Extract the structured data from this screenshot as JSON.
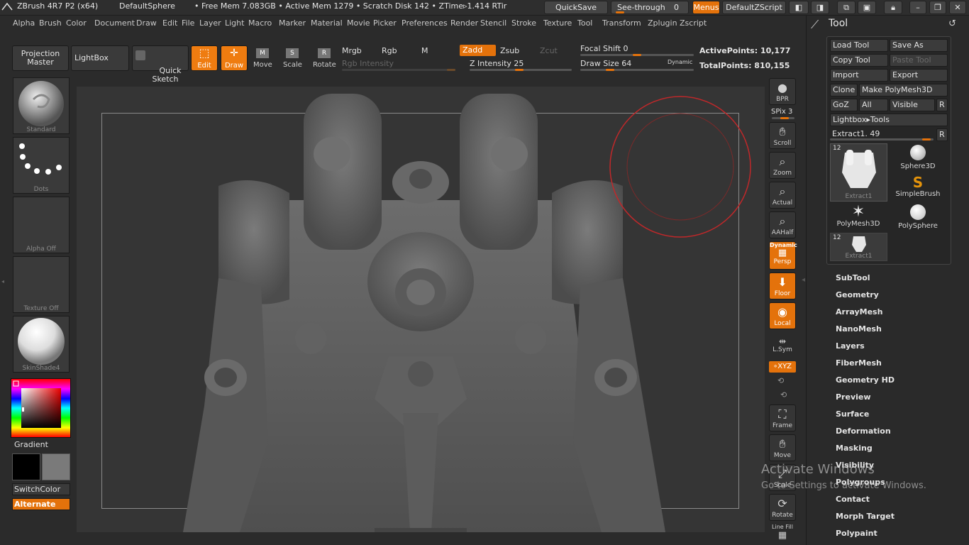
{
  "titlebar": {
    "app": "ZBrush 4R7 P2 (x64)",
    "document": "DefaultSphere",
    "stats": "• Free Mem 7.083GB • Active Mem 1279 • Scratch Disk 142 •  ZTime▹1.414 RTir",
    "quicksave": "QuickSave",
    "see_through": "See-through",
    "see_through_value": "0",
    "menus": "Menus",
    "zscript": "DefaultZScript"
  },
  "menubar": {
    "items": [
      "Alpha",
      "Brush",
      "Color",
      "Document",
      "Draw",
      "Edit",
      "File",
      "Layer",
      "Light",
      "Macro",
      "Marker",
      "Material",
      "Movie",
      "Picker",
      "Preferences",
      "Render",
      "Stencil",
      "Stroke",
      "Texture",
      "Tool",
      "Transform",
      "Zplugin",
      "Zscript"
    ]
  },
  "toolbar": {
    "projection_master": "Projection\nMaster",
    "lightbox": "LightBox",
    "quick_sketch": "Quick\nSketch",
    "edit": "Edit",
    "draw": "Draw",
    "move": "Move",
    "scale": "Scale",
    "rotate": "Rotate",
    "mrgb": "Mrgb",
    "rgb": "Rgb",
    "m": "M",
    "zadd": "Zadd",
    "zsub": "Zsub",
    "zcut": "Zcut",
    "rgb_intensity": "Rgb  Intensity",
    "z_intensity": "Z Intensity 25",
    "z_intensity_value": 25,
    "focal_shift": "Focal Shift 0",
    "focal_shift_value": 0,
    "draw_size": "Draw Size 64",
    "draw_size_value": 64,
    "dynamic": "Dynamic",
    "active_points": "ActivePoints: 10,177",
    "total_points": "TotalPoints: 810,155"
  },
  "leftshelf": {
    "brush": "Standard",
    "stroke": "Dots",
    "alpha": "Alpha  Off",
    "texture": "Texture  Off",
    "material": "SkinShade4",
    "gradient": "Gradient",
    "switch_color": "SwitchColor",
    "alternate": "Alternate"
  },
  "rightshelf": {
    "bpr": "BPR",
    "spix": "SPix 3",
    "scroll": "Scroll",
    "zoom": "Zoom",
    "actual": "Actual",
    "aahalf": "AAHalf",
    "dynamic": "Dynamic",
    "persp": "Persp",
    "floor": "Floor",
    "local": "Local",
    "lsym": "L.Sym",
    "xyz": "∘XYZ",
    "frame": "Frame",
    "move": "Move",
    "scale": "Scale",
    "rotate": "Rotate",
    "line_fill": "Line Fill"
  },
  "toolpanel": {
    "title": "Tool",
    "load_tool": "Load Tool",
    "save_as": "Save As",
    "copy_tool": "Copy Tool",
    "paste_tool": "Paste Tool",
    "import": "Import",
    "export": "Export",
    "clone": "Clone",
    "make_polymesh": "Make PolyMesh3D",
    "goz": "GoZ",
    "all": "All",
    "visible": "Visible",
    "r": "R",
    "lightbox_tools": "Lightbox▸Tools",
    "extract_label": "Extract1. 49",
    "extract_value": 49,
    "tools": [
      {
        "name": "Extract1",
        "count": "12"
      },
      {
        "name": "Sphere3D",
        "count": ""
      },
      {
        "name": "SimpleBrush",
        "count": ""
      },
      {
        "name": "PolyMesh3D",
        "count": ""
      },
      {
        "name": "PolySphere",
        "count": ""
      },
      {
        "name": "Extract1",
        "count": "12"
      }
    ],
    "subpalettes": [
      "SubTool",
      "Geometry",
      "ArrayMesh",
      "NanoMesh",
      "Layers",
      "FiberMesh",
      "Geometry HD",
      "Preview",
      "Surface",
      "Deformation",
      "Masking",
      "Visibility",
      "Polygroups",
      "Contact",
      "Morph Target",
      "Polypaint"
    ]
  },
  "watermark": {
    "line1": "Activate Windows",
    "line2": "Go to Settings to activate Windows."
  },
  "colors": {
    "accent": "#e4720b",
    "background": "#2b2b2b",
    "brush_circle": "#c0282a"
  }
}
